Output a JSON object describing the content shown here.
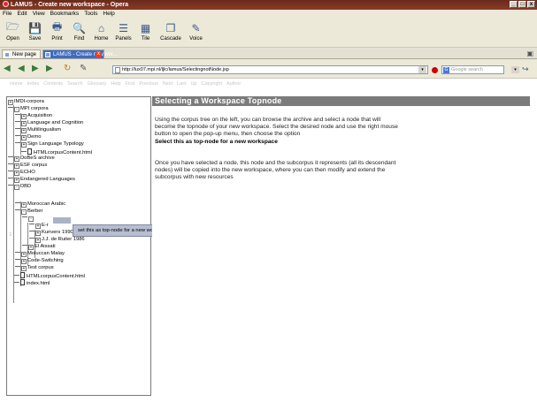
{
  "window": {
    "title": "LAMUS - Create new workspace - Opera",
    "buttons": [
      "_",
      "□",
      "x"
    ]
  },
  "menubar": [
    "File",
    "Edit",
    "View",
    "Bookmarks",
    "Tools",
    "Help"
  ],
  "toolbar": [
    {
      "label": "Open",
      "icon": "folder-open-icon",
      "glyph": "🗁"
    },
    {
      "label": "Save",
      "icon": "save-icon",
      "glyph": "💾"
    },
    {
      "label": "Print",
      "icon": "print-icon",
      "glyph": "🖶"
    },
    {
      "label": "Find",
      "icon": "find-icon",
      "glyph": "🔍"
    },
    {
      "label": "Home",
      "icon": "home-icon",
      "glyph": "⌂"
    },
    {
      "label": "Panels",
      "icon": "panels-icon",
      "glyph": "☰"
    },
    {
      "label": "Tile",
      "icon": "tile-icon",
      "glyph": "▦"
    },
    {
      "label": "Cascade",
      "icon": "cascade-icon",
      "glyph": "❐"
    },
    {
      "label": "Voice",
      "icon": "voice-icon",
      "glyph": "✎"
    }
  ],
  "tabs": {
    "new_page": "New page",
    "active": "LAMUS - Create new wor...",
    "close": "x"
  },
  "address": {
    "url": "http://lux07.mpi.nl/ljlc/lamus/SelectingnotNode.jsp",
    "search_placeholder": "Google search",
    "search_badge": "G",
    "dropdown": "▾",
    "go": "↪"
  },
  "nav_glyphs": [
    "◀",
    "◀",
    "▶",
    "▶",
    "↻",
    "✎"
  ],
  "linkbar": [
    "Home",
    "Index",
    "Contents",
    "Search",
    "Glossary",
    "Help",
    "First",
    "Previous",
    "Next",
    "Last",
    "Up",
    "Copyright",
    "Author"
  ],
  "tree": {
    "nodes": [
      {
        "label": "IMDI-corpora",
        "expander": "+"
      },
      {
        "label": "MPI corpora",
        "expander": "-"
      },
      {
        "label": "Acquisition",
        "expander": "+"
      },
      {
        "label": "Language and Cognition",
        "expander": "+"
      },
      {
        "label": "Multilingualism",
        "expander": "+"
      },
      {
        "label": "Demo",
        "expander": "+"
      },
      {
        "label": "Sign Language Typology",
        "expander": "+"
      },
      {
        "label": "HTMLcorpusContent.html",
        "expander": ""
      },
      {
        "label": "DoBeS archive",
        "expander": "+"
      },
      {
        "label": "ESF corpus",
        "expander": "+"
      },
      {
        "label": "ECHO",
        "expander": "+"
      },
      {
        "label": "Endangered Languages",
        "expander": "+"
      },
      {
        "label": "DBD",
        "expander": "-"
      },
      {
        "label": "Moroccan Arabic",
        "expander": "+"
      },
      {
        "label": "Berber",
        "expander": "-"
      },
      {
        "label": "",
        "expander": "-"
      },
      {
        "label": "E-r",
        "expander": "+"
      },
      {
        "label": "Kunvers 1990",
        "expander": "+"
      },
      {
        "label": "J.J. de Ruiter 1986",
        "expander": "+"
      },
      {
        "label": "El Aissati",
        "expander": "+"
      },
      {
        "label": "Moluccan Malay",
        "expander": "+"
      },
      {
        "label": "Code-Switching",
        "expander": "+"
      },
      {
        "label": "Test corpus",
        "expander": "+"
      },
      {
        "label": "HTMLcorpusContent.html",
        "expander": ""
      },
      {
        "label": "index.html",
        "expander": ""
      }
    ],
    "context_menu": "set this as top-node for a new workspace",
    "scroll_mark": "⁝"
  },
  "main": {
    "heading": "Selecting a Workspace Topnode",
    "para1": "Using the corpus tree on the left, you can browse the archive and select a node that will become the topnode of your new workspace. Select the desired node and use the right mouse button to open the pop-up menu, then choose the option",
    "para1_bold": "Select this as top-node for a new workspace",
    "para2": "Once you have selected a node, this node and the subcorpus it represents (all its descendant nodes) will be copied into the new workspace, where you can then modify and extend the subcorpus with new resources"
  }
}
